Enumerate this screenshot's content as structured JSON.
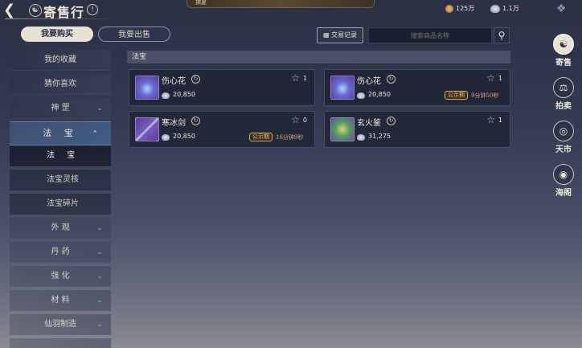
{
  "header": {
    "title": "寄售行",
    "help": "!",
    "title_icon": "yin-yang",
    "banner": "拂夏",
    "gold_amount": "125万",
    "silver_amount": "1.1万"
  },
  "tabs": {
    "buy": "我要购买",
    "sell": "我要出售"
  },
  "sidebar": {
    "items": [
      {
        "label": "我的收藏"
      },
      {
        "label": "猜你喜欢"
      },
      {
        "label": "神 罡"
      },
      {
        "label": "法 宝"
      },
      {
        "label": "法 宝"
      },
      {
        "label": "法宝灵核"
      },
      {
        "label": "法宝碎片"
      },
      {
        "label": "外 观"
      },
      {
        "label": "丹 药"
      },
      {
        "label": "强 化"
      },
      {
        "label": "材 料"
      },
      {
        "label": "仙羽制造"
      }
    ]
  },
  "toolbar": {
    "history_label": "交易记录",
    "search_placeholder": "搜索商品名称"
  },
  "section_title": "法宝",
  "items": [
    {
      "name": "伤心花",
      "stars": "1",
      "price": "20,850",
      "icon": "lotus-icon",
      "badge": "",
      "time": ""
    },
    {
      "name": "伤心花",
      "stars": "1",
      "price": "20,850",
      "icon": "lotus-icon",
      "badge": "公示期",
      "time": "9分钟50秒"
    },
    {
      "name": "寒冰剑",
      "stars": "0",
      "price": "20,850",
      "icon": "sword-icon",
      "badge": "公示期",
      "time": "16分钟9秒"
    },
    {
      "name": "玄火鉴",
      "stars": "1",
      "price": "31,275",
      "icon": "mirror-icon",
      "badge": "",
      "time": ""
    }
  ],
  "right_nav": [
    {
      "label": "寄售",
      "icon": "consign-icon"
    },
    {
      "label": "拍卖",
      "icon": "auction-icon"
    },
    {
      "label": "天市",
      "icon": "market-icon"
    },
    {
      "label": "海阁",
      "icon": "pavilion-icon"
    }
  ],
  "colors": {
    "badge": "#d8a850",
    "active_tab": "#e6e2d4",
    "panel": "#1c2030"
  }
}
